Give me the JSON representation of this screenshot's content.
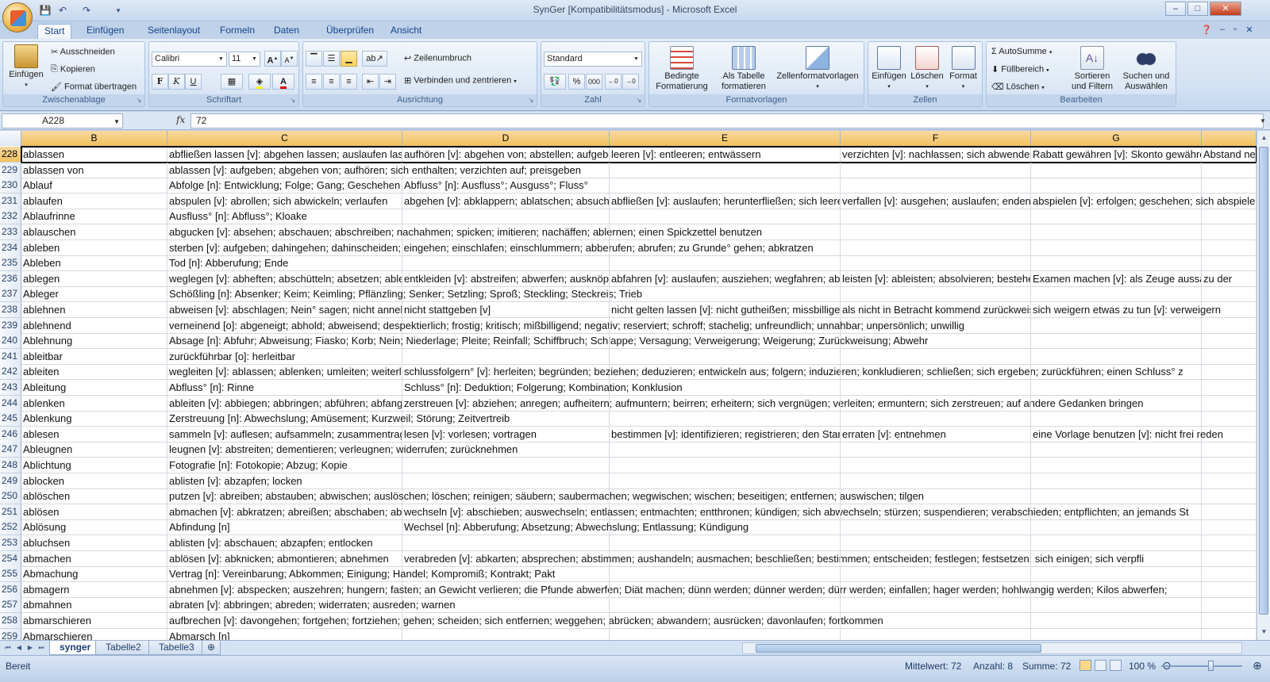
{
  "window": {
    "title": "SynGer  [Kompatibilitätsmodus]  -  Microsoft Excel",
    "min": "–",
    "max": "□",
    "close": "✕"
  },
  "ribbon_tabs": [
    "Start",
    "Einfügen",
    "Seitenlayout",
    "Formeln",
    "Daten",
    "Überprüfen",
    "Ansicht"
  ],
  "clipboard": {
    "paste": "Einfügen",
    "cut": "Ausschneiden",
    "copy": "Kopieren",
    "format_painter": "Format übertragen",
    "label": "Zwischenablage"
  },
  "font": {
    "name": "Calibri",
    "size": "11",
    "grow": "A",
    "shrink": "A",
    "bold": "F",
    "italic": "K",
    "underline": "U",
    "label": "Schriftart",
    "accent_fill": "#ffff00",
    "accent_font": "#e00000"
  },
  "alignment": {
    "wrap_text": "Zeilenumbruch",
    "merge_center": "Verbinden und zentrieren",
    "label": "Ausrichtung"
  },
  "number": {
    "format": "Standard",
    "percent": "%",
    "thousands": "000",
    "label": "Zahl"
  },
  "styles": {
    "conditional": [
      "Bedingte",
      "Formatierung"
    ],
    "as_table": [
      "Als Tabelle",
      "formatieren"
    ],
    "cell_styles": "Zellenformatvorlagen",
    "label": "Formatvorlagen"
  },
  "cells": {
    "insert": "Einfügen",
    "delete": "Löschen",
    "format": "Format",
    "label": "Zellen"
  },
  "editing": {
    "autosum": "AutoSumme",
    "fill": "Füllbereich",
    "clear": "Löschen",
    "sort": [
      "Sortieren",
      "und Filtern"
    ],
    "find": [
      "Suchen und",
      "Auswählen"
    ],
    "label": "Bearbeiten"
  },
  "formula_bar": {
    "name_box": "A228",
    "fx": "fx",
    "value": "72"
  },
  "columns": [
    "B",
    "C",
    "D",
    "E",
    "F",
    "G"
  ],
  "rows": [
    {
      "n": "228",
      "b": "ablassen",
      "c": "abfließen lassen [v]: abgehen lassen; auslaufen lassen",
      "d": "aufhören [v]: abgehen von; abstellen; aufgeben",
      "e": "leeren [v]: entleeren; entwässern",
      "f": "verzichten [v]: nachlassen; sich abwenden",
      "g": "Rabatt gewähren [v]: Skonto gewähren",
      "h": "Abstand nehmen"
    },
    {
      "n": "229",
      "b": "ablassen von",
      "c": "ablassen [v]: aufgeben; abgehen von; aufhören; sich enthalten; verzichten auf; preisgeben",
      "d": "",
      "e": "",
      "f": "",
      "g": "",
      "h": ""
    },
    {
      "n": "230",
      "b": "Ablauf",
      "c": "Abfolge [n]: Entwicklung; Folge; Gang; Geschehen",
      "d": "Abfluss° [n]: Ausfluss°; Ausguss°; Fluss°",
      "e": "",
      "f": "",
      "g": "",
      "h": ""
    },
    {
      "n": "231",
      "b": "ablaufen",
      "c": "abspulen [v]: abrollen; sich abwickeln; verlaufen",
      "d": "abgehen [v]: abklappern; ablatschen; absuchen",
      "e": "abfließen [v]: auslaufen; herunterfließen; sich leeren",
      "f": "verfallen [v]: ausgehen; auslaufen; enden",
      "g": "abspielen [v]: erfolgen; geschehen; sich abspielen",
      "h": ""
    },
    {
      "n": "232",
      "b": "Ablaufrinne",
      "c": "Ausfluss° [n]: Abfluss°; Kloake",
      "d": "",
      "e": "",
      "f": "",
      "g": "",
      "h": ""
    },
    {
      "n": "233",
      "b": "ablauschen",
      "c": "abgucken [v]: absehen; abschauen; abschreiben; nachahmen; spicken; imitieren; nachäffen; ablernen; einen Spickzettel benutzen",
      "d": "",
      "e": "",
      "f": "",
      "g": "",
      "h": ""
    },
    {
      "n": "234",
      "b": "ableben",
      "c": "sterben [v]: aufgeben; dahingehen; dahinscheiden; eingehen; einschlafen; einschlummern; abberufen; abrufen; zu Grunde° gehen; abkratzen",
      "d": "",
      "e": "",
      "f": "",
      "g": "",
      "h": ""
    },
    {
      "n": "235",
      "b": "Ableben",
      "c": "Tod [n]: Abberufung; Ende",
      "d": "",
      "e": "",
      "f": "",
      "g": "",
      "h": ""
    },
    {
      "n": "236",
      "b": "ablegen",
      "c": "weglegen [v]: abheften; abschütteln; absetzen; ablegen",
      "d": "entkleiden [v]: abstreifen; abwerfen; ausknöpfen",
      "e": "abfahren [v]: auslaufen; ausziehen; wegfahren; ablegen",
      "f": "leisten [v]: ableisten; absolvieren; bestehen",
      "g": "Examen machen [v]: als Zeuge aussagen",
      "h": "zu der"
    },
    {
      "n": "237",
      "b": "Ableger",
      "c": "Schößling [n]: Absenker; Keim; Keimling; Pflänzling; Senker; Setzling; Sproß; Steckling; Steckreis; Trieb",
      "d": "",
      "e": "",
      "f": "",
      "g": "",
      "h": ""
    },
    {
      "n": "238",
      "b": "ablehnen",
      "c": "abweisen [v]: abschlagen; Nein° sagen; nicht annehmen",
      "d": "nicht stattgeben [v]",
      "e": "nicht gelten lassen [v]: nicht gutheißen; missbilligen",
      "f": "als nicht in Betracht kommend zurückweisen",
      "g": "sich weigern etwas zu tun [v]: verweigern",
      "h": ""
    },
    {
      "n": "239",
      "b": "ablehnend",
      "c": "verneinend [o]: abgeneigt; abhold; abweisend; despektierlich; frostig; kritisch; mißbilligend; negativ; reserviert; schroff; stachelig; unfreundlich; unnahbar; unpersönlich; unwillig",
      "d": "",
      "e": "",
      "f": "",
      "g": "",
      "h": ""
    },
    {
      "n": "240",
      "b": "Ablehnung",
      "c": "Absage [n]: Abfuhr; Abweisung; Fiasko; Korb; Nein; Niederlage; Pleite; Reinfall; Schiffbruch; Schlappe; Versagung; Verweigerung; Weigerung; Zurückweisung; Abwehr",
      "d": "",
      "e": "",
      "f": "",
      "g": "",
      "h": ""
    },
    {
      "n": "241",
      "b": "ableitbar",
      "c": "zurückführbar [o]: herleitbar",
      "d": "",
      "e": "",
      "f": "",
      "g": "",
      "h": ""
    },
    {
      "n": "242",
      "b": "ableiten",
      "c": "wegleiten [v]: ablassen; ablenken; umleiten; weiterleiten",
      "d": "schlussfolgern° [v]: herleiten; begründen; beziehen; deduzieren; entwickeln aus; folgern; induzieren; konkludieren; schließen; sich ergeben; zurückführen; einen Schluss° z",
      "e": "",
      "f": "",
      "g": "",
      "h": ""
    },
    {
      "n": "243",
      "b": "Ableitung",
      "c": "Abfluss° [n]: Rinne",
      "d": "Schluss° [n]: Deduktion; Folgerung; Kombination; Konklusion",
      "e": "",
      "f": "",
      "g": "",
      "h": ""
    },
    {
      "n": "244",
      "b": "ablenken",
      "c": "ableiten [v]: abbiegen; abbringen; abführen; abfangen",
      "d": "zerstreuen [v]: abziehen; anregen; aufheitern; aufmuntern; beirren; erheitern; sich vergnügen; verleiten; ermuntern; sich zerstreuen; auf andere Gedanken bringen",
      "e": "",
      "f": "",
      "g": "",
      "h": ""
    },
    {
      "n": "245",
      "b": "Ablenkung",
      "c": "Zerstreuung [n]: Abwechslung; Amüsement; Kurzweil; Störung; Zeitvertreib",
      "d": "",
      "e": "",
      "f": "",
      "g": "",
      "h": ""
    },
    {
      "n": "246",
      "b": "ablesen",
      "c": "sammeln [v]: auflesen; aufsammeln; zusammentragen",
      "d": "lesen [v]: vorlesen; vortragen",
      "e": "bestimmen [v]: identifizieren; registrieren; den Stand",
      "f": "erraten [v]: entnehmen",
      "g": "eine Vorlage benutzen [v]: nicht frei reden",
      "h": ""
    },
    {
      "n": "247",
      "b": "Ableugnen",
      "c": "leugnen [v]: abstreiten; dementieren; verleugnen; widerrufen; zurücknehmen",
      "d": "",
      "e": "",
      "f": "",
      "g": "",
      "h": ""
    },
    {
      "n": "248",
      "b": "Ablichtung",
      "c": "Fotografie [n]: Fotokopie; Abzug; Kopie",
      "d": "",
      "e": "",
      "f": "",
      "g": "",
      "h": ""
    },
    {
      "n": "249",
      "b": "ablocken",
      "c": "ablisten [v]: abzapfen; locken",
      "d": "",
      "e": "",
      "f": "",
      "g": "",
      "h": ""
    },
    {
      "n": "250",
      "b": "ablöschen",
      "c": "putzen [v]: abreiben; abstauben; abwischen; auslöschen; löschen; reinigen; säubern; saubermachen; wegwischen; wischen; beseitigen; entfernen; auswischen; tilgen",
      "d": "",
      "e": "",
      "f": "",
      "g": "",
      "h": ""
    },
    {
      "n": "251",
      "b": "ablösen",
      "c": "abmachen [v]: abkratzen; abreißen; abschaben; ablösen",
      "d": "wechseln [v]: abschieben; auswechseln; entlassen; entmachten; entthronen; kündigen; sich abwechseln; stürzen; suspendieren; verabschieden; entpflichten; an jemands St",
      "e": "",
      "f": "",
      "g": "",
      "h": ""
    },
    {
      "n": "252",
      "b": "Ablösung",
      "c": "Abfindung [n]",
      "d": "Wechsel [n]: Abberufung; Absetzung; Abwechslung; Entlassung; Kündigung",
      "e": "",
      "f": "",
      "g": "",
      "h": ""
    },
    {
      "n": "253",
      "b": "abluchsen",
      "c": "ablisten [v]: abschauen; abzapfen; entlocken",
      "d": "",
      "e": "",
      "f": "",
      "g": "",
      "h": ""
    },
    {
      "n": "254",
      "b": "abmachen",
      "c": "ablösen [v]: abknicken; abmontieren; abnehmen",
      "d": "verabreden [v]: abkarten; absprechen; abstimmen; aushandeln; ausmachen; beschließen; bestimmen; entscheiden; festlegen; festsetzen; sich einigen; sich verpfli",
      "e": "",
      "f": "",
      "g": "",
      "h": ""
    },
    {
      "n": "255",
      "b": "Abmachung",
      "c": "Vertrag [n]: Vereinbarung; Abkommen; Einigung; Handel; Kompromiß; Kontrakt; Pakt",
      "d": "",
      "e": "",
      "f": "",
      "g": "",
      "h": ""
    },
    {
      "n": "256",
      "b": "abmagern",
      "c": "abnehmen [v]: abspecken; auszehren; hungern; fasten; an Gewicht verlieren; die Pfunde abwerfen; Diät machen; dünn werden; dünner werden; dürr werden; einfallen; hager werden; hohlwangig werden; Kilos abwerfen;",
      "d": "",
      "e": "",
      "f": "",
      "g": "",
      "h": ""
    },
    {
      "n": "257",
      "b": "abmahnen",
      "c": "abraten [v]: abbringen; abreden; widerraten; ausreden; warnen",
      "d": "",
      "e": "",
      "f": "",
      "g": "",
      "h": ""
    },
    {
      "n": "258",
      "b": "abmarschieren",
      "c": "aufbrechen [v]: davongehen; fortgehen; fortziehen; gehen; scheiden; sich entfernen; weggehen; abrücken; abwandern; ausrücken; davonlaufen; fortkommen",
      "d": "",
      "e": "",
      "f": "",
      "g": "",
      "h": ""
    },
    {
      "n": "259",
      "b": "Abmarschieren",
      "c": "Abmarsch [n]",
      "d": "",
      "e": "",
      "f": "",
      "g": "",
      "h": ""
    }
  ],
  "sheets": [
    "synger",
    "Tabelle2",
    "Tabelle3"
  ],
  "status": {
    "ready": "Bereit",
    "average": "Mittelwert: 72",
    "count": "Anzahl: 8",
    "sum": "Summe: 72",
    "zoom": "100 %"
  }
}
